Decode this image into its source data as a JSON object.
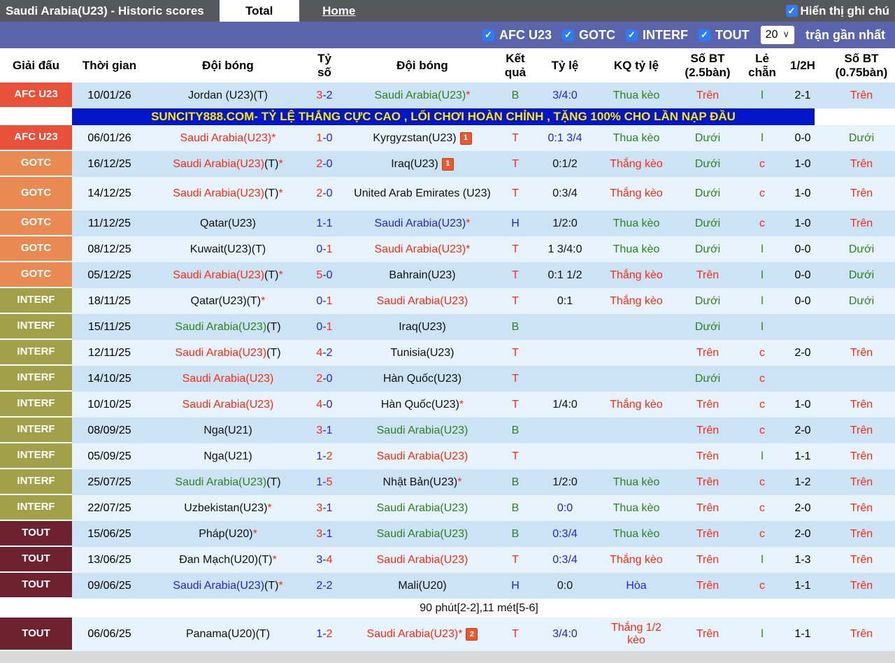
{
  "header": {
    "title": "Saudi Arabia(U23) - Historic scores",
    "tabs": [
      {
        "label": "Total",
        "active": true
      },
      {
        "label": "Home",
        "active": false
      }
    ],
    "note_toggle": "Hiển thị ghi chú"
  },
  "filters": {
    "competitions": [
      "AFC U23",
      "GOTC",
      "INTERF",
      "TOUT"
    ],
    "count_value": "20",
    "count_suffix": "trận gần nhất"
  },
  "ad": {
    "text": "SUNCITY888.COM- TỶ LỆ THẮNG CỰC CAO , LỐI CHƠI HOÀN CHỈNH , TẶNG 100% CHO LẦN NẠP ĐẦU",
    "bg": "#0016c8",
    "fg": "#ffe600"
  },
  "note_row": {
    "text": "90 phút[2-2],11 mét[5-6]"
  },
  "colors": {
    "win_text": "#fe2a10",
    "loss_text": "#31811c",
    "draw_text": "#2323dc",
    "row_dark": "#cbe3f4",
    "row_light": "#e7f3fb",
    "filter_bar": "#5964ad",
    "title_bar": "#57585c"
  },
  "table": {
    "columns": [
      "Giải đấu",
      "Thời gian",
      "Đội bóng",
      "Tỷ số",
      "Đội bóng",
      "Kết quả",
      "Tỷ lệ",
      "KQ tỷ lệ",
      "Số BT (2.5bàn)",
      "Lẻ chẵn",
      "1/2H",
      "Số BT (0.75bàn)"
    ],
    "league_colors": {
      "AFC U23": "#e8503a",
      "GOTC": "#e98a52",
      "INTERF": "#a3a04a",
      "TOUT": "#6e2230"
    },
    "rows": [
      {
        "league": "AFC U23",
        "date": "10/01/26",
        "home": [
          [
            "Jordan (U23)(T)",
            "k"
          ]
        ],
        "score": [
          "3",
          "r",
          "2",
          "b"
        ],
        "away": [
          [
            "Saudi Arabia(U23)",
            "g"
          ],
          [
            "*",
            "r"
          ]
        ],
        "res": [
          "B",
          "g"
        ],
        "odds": [
          "3/4:0",
          "b"
        ],
        "kq": [
          "Thua kèo",
          "g"
        ],
        "ou25": [
          "Trên",
          "r"
        ],
        "oe": [
          "l",
          "g"
        ],
        "ht": "2-1",
        "ou075": [
          "Trên",
          "r"
        ],
        "after": "ad"
      },
      {
        "league": "AFC U23",
        "date": "06/01/26",
        "home": [
          [
            "Saudi Arabia(U23)",
            "r"
          ],
          [
            "*",
            "r"
          ]
        ],
        "score": [
          "1",
          "r",
          "0",
          "b"
        ],
        "away": [
          [
            "Kyrgyzstan(U23)",
            "k"
          ]
        ],
        "note_badge": "1",
        "res": [
          "T",
          "r"
        ],
        "odds": [
          "0:1 3/4",
          "b"
        ],
        "kq": [
          "Thua kèo",
          "g"
        ],
        "ou25": [
          "Dưới",
          "g"
        ],
        "oe": [
          "l",
          "g"
        ],
        "ht": "0-0",
        "ou075": [
          "Dưới",
          "g"
        ]
      },
      {
        "league": "GOTC",
        "date": "16/12/25",
        "home": [
          [
            "Saudi Arabia(U23)",
            "r"
          ],
          [
            "(T)",
            "k"
          ],
          [
            "*",
            "r"
          ]
        ],
        "score": [
          "2",
          "r",
          "0",
          "b"
        ],
        "away": [
          [
            "Iraq(U23)",
            "k"
          ]
        ],
        "note_badge": "1",
        "res": [
          "T",
          "r"
        ],
        "odds": [
          "0:1/2",
          "k"
        ],
        "kq": [
          "Thắng kèo",
          "r"
        ],
        "ou25": [
          "Dưới",
          "g"
        ],
        "oe": [
          "c",
          "r"
        ],
        "ht": "1-0",
        "ou075": [
          "Trên",
          "r"
        ]
      },
      {
        "league": "GOTC",
        "date": "14/12/25",
        "home": [
          [
            "Saudi Arabia(U23)",
            "r"
          ],
          [
            "(T)",
            "k"
          ],
          [
            "*",
            "r"
          ]
        ],
        "score": [
          "2",
          "r",
          "0",
          "b"
        ],
        "away": [
          [
            "United Arab Emirates (U23)",
            "k"
          ]
        ],
        "res": [
          "T",
          "r"
        ],
        "odds": [
          "0:3/4",
          "k"
        ],
        "kq": [
          "Thắng kèo",
          "r"
        ],
        "ou25": [
          "Dưới",
          "g"
        ],
        "oe": [
          "c",
          "r"
        ],
        "ht": "1-0",
        "ou075": [
          "Trên",
          "r"
        ],
        "tall": true
      },
      {
        "league": "GOTC",
        "date": "11/12/25",
        "home": [
          [
            "Qatar(U23)",
            "k"
          ]
        ],
        "score": [
          "1",
          "b",
          "1",
          "b"
        ],
        "away": [
          [
            "Saudi Arabia(U23)",
            "b"
          ],
          [
            "*",
            "r"
          ]
        ],
        "res": [
          "H",
          "b"
        ],
        "odds": [
          "1/2:0",
          "k"
        ],
        "kq": [
          "Thua kèo",
          "g"
        ],
        "ou25": [
          "Dưới",
          "g"
        ],
        "oe": [
          "c",
          "r"
        ],
        "ht": "1-0",
        "ou075": [
          "Trên",
          "r"
        ]
      },
      {
        "league": "GOTC",
        "date": "08/12/25",
        "home": [
          [
            "Kuwait(U23)(T)",
            "k"
          ]
        ],
        "score": [
          "0",
          "b",
          "1",
          "r"
        ],
        "away": [
          [
            "Saudi Arabia(U23)",
            "r"
          ],
          [
            "*",
            "r"
          ]
        ],
        "res": [
          "T",
          "r"
        ],
        "odds": [
          "1 3/4:0",
          "k"
        ],
        "kq": [
          "Thua kèo",
          "g"
        ],
        "ou25": [
          "Dưới",
          "g"
        ],
        "oe": [
          "l",
          "g"
        ],
        "ht": "0-0",
        "ou075": [
          "Dưới",
          "g"
        ]
      },
      {
        "league": "GOTC",
        "date": "05/12/25",
        "home": [
          [
            "Saudi Arabia(U23)",
            "r"
          ],
          [
            "(T)",
            "k"
          ],
          [
            "*",
            "r"
          ]
        ],
        "score": [
          "5",
          "r",
          "0",
          "b"
        ],
        "away": [
          [
            "Bahrain(U23)",
            "k"
          ]
        ],
        "res": [
          "T",
          "r"
        ],
        "odds": [
          "0:1 1/2",
          "k"
        ],
        "kq": [
          "Thắng kèo",
          "r"
        ],
        "ou25": [
          "Trên",
          "r"
        ],
        "oe": [
          "l",
          "g"
        ],
        "ht": "0-0",
        "ou075": [
          "Dưới",
          "g"
        ]
      },
      {
        "league": "INTERF",
        "date": "18/11/25",
        "home": [
          [
            "Qatar(U23)(T)",
            "k"
          ],
          [
            "*",
            "r"
          ]
        ],
        "score": [
          "0",
          "b",
          "1",
          "r"
        ],
        "away": [
          [
            "Saudi Arabia(U23)",
            "r"
          ]
        ],
        "res": [
          "T",
          "r"
        ],
        "odds": [
          "0:1",
          "k"
        ],
        "kq": [
          "Thắng kèo",
          "r"
        ],
        "ou25": [
          "Dưới",
          "g"
        ],
        "oe": [
          "l",
          "g"
        ],
        "ht": "0-0",
        "ou075": [
          "Dưới",
          "g"
        ]
      },
      {
        "league": "INTERF",
        "date": "15/11/25",
        "home": [
          [
            "Saudi Arabia(U23)",
            "g"
          ],
          [
            "(T)",
            "k"
          ]
        ],
        "score": [
          "0",
          "b",
          "1",
          "r"
        ],
        "away": [
          [
            "Iraq(U23)",
            "k"
          ]
        ],
        "res": [
          "B",
          "g"
        ],
        "ou25": [
          "Dưới",
          "g"
        ],
        "oe": [
          "l",
          "g"
        ]
      },
      {
        "league": "INTERF",
        "date": "12/11/25",
        "home": [
          [
            "Saudi Arabia(U23)",
            "r"
          ],
          [
            "(T)",
            "k"
          ]
        ],
        "score": [
          "4",
          "r",
          "2",
          "b"
        ],
        "away": [
          [
            "Tunisia(U23)",
            "k"
          ]
        ],
        "res": [
          "T",
          "r"
        ],
        "ou25": [
          "Trên",
          "r"
        ],
        "oe": [
          "c",
          "r"
        ],
        "ht": "2-0",
        "ou075": [
          "Trên",
          "r"
        ]
      },
      {
        "league": "INTERF",
        "date": "14/10/25",
        "home": [
          [
            "Saudi Arabia(U23)",
            "r"
          ]
        ],
        "score": [
          "2",
          "r",
          "0",
          "b"
        ],
        "away": [
          [
            "Hàn Quốc(U23)",
            "k"
          ]
        ],
        "res": [
          "T",
          "r"
        ],
        "ou25": [
          "Dưới",
          "g"
        ],
        "oe": [
          "c",
          "r"
        ]
      },
      {
        "league": "INTERF",
        "date": "10/10/25",
        "home": [
          [
            "Saudi Arabia(U23)",
            "r"
          ]
        ],
        "score": [
          "4",
          "r",
          "0",
          "b"
        ],
        "away": [
          [
            "Hàn Quốc(U23)",
            "k"
          ],
          [
            "*",
            "r"
          ]
        ],
        "res": [
          "T",
          "r"
        ],
        "odds": [
          "1/4:0",
          "k"
        ],
        "kq": [
          "Thắng kèo",
          "r"
        ],
        "ou25": [
          "Trên",
          "r"
        ],
        "oe": [
          "c",
          "r"
        ],
        "ht": "1-0",
        "ou075": [
          "Trên",
          "r"
        ]
      },
      {
        "league": "INTERF",
        "date": "08/09/25",
        "home": [
          [
            "Nga(U21)",
            "k"
          ]
        ],
        "score": [
          "3",
          "r",
          "1",
          "b"
        ],
        "away": [
          [
            "Saudi Arabia(U23)",
            "g"
          ]
        ],
        "res": [
          "B",
          "g"
        ],
        "ou25": [
          "Trên",
          "r"
        ],
        "oe": [
          "c",
          "r"
        ],
        "ht": "2-0",
        "ou075": [
          "Trên",
          "r"
        ]
      },
      {
        "league": "INTERF",
        "date": "05/09/25",
        "home": [
          [
            "Nga(U21)",
            "k"
          ]
        ],
        "score": [
          "1",
          "b",
          "2",
          "r"
        ],
        "away": [
          [
            "Saudi Arabia(U23)",
            "r"
          ]
        ],
        "res": [
          "T",
          "r"
        ],
        "ou25": [
          "Trên",
          "r"
        ],
        "oe": [
          "l",
          "g"
        ],
        "ht": "1-1",
        "ou075": [
          "Trên",
          "r"
        ]
      },
      {
        "league": "INTERF",
        "date": "25/07/25",
        "home": [
          [
            "Saudi Arabia(U23)",
            "g"
          ],
          [
            "(T)",
            "k"
          ]
        ],
        "score": [
          "1",
          "b",
          "5",
          "r"
        ],
        "away": [
          [
            "Nhật Bản(U23)",
            "k"
          ],
          [
            "*",
            "r"
          ]
        ],
        "res": [
          "B",
          "g"
        ],
        "odds": [
          "1/2:0",
          "k"
        ],
        "kq": [
          "Thua kèo",
          "g"
        ],
        "ou25": [
          "Trên",
          "r"
        ],
        "oe": [
          "c",
          "r"
        ],
        "ht": "1-2",
        "ou075": [
          "Trên",
          "r"
        ]
      },
      {
        "league": "INTERF",
        "date": "22/07/25",
        "home": [
          [
            "Uzbekistan(U23)",
            "k"
          ],
          [
            "*",
            "r"
          ]
        ],
        "score": [
          "3",
          "r",
          "1",
          "b"
        ],
        "away": [
          [
            "Saudi Arabia(U23)",
            "g"
          ]
        ],
        "res": [
          "B",
          "g"
        ],
        "odds": [
          "0:0",
          "b"
        ],
        "kq": [
          "Thua kèo",
          "g"
        ],
        "ou25": [
          "Trên",
          "r"
        ],
        "oe": [
          "c",
          "r"
        ],
        "ht": "2-0",
        "ou075": [
          "Trên",
          "r"
        ]
      },
      {
        "league": "TOUT",
        "date": "15/06/25",
        "home": [
          [
            "Pháp(U20)",
            "k"
          ],
          [
            "*",
            "r"
          ]
        ],
        "score": [
          "3",
          "r",
          "1",
          "b"
        ],
        "away": [
          [
            "Saudi Arabia(U23)",
            "g"
          ]
        ],
        "res": [
          "B",
          "g"
        ],
        "odds": [
          "0:3/4",
          "b"
        ],
        "kq": [
          "Thua kèo",
          "g"
        ],
        "ou25": [
          "Trên",
          "r"
        ],
        "oe": [
          "c",
          "r"
        ],
        "ht": "2-0",
        "ou075": [
          "Trên",
          "r"
        ]
      },
      {
        "league": "TOUT",
        "date": "13/06/25",
        "home": [
          [
            "Đan Mạch(U20)(T)",
            "k"
          ],
          [
            "*",
            "r"
          ]
        ],
        "score": [
          "3",
          "b",
          "4",
          "r"
        ],
        "away": [
          [
            "Saudi Arabia(U23)",
            "r"
          ]
        ],
        "res": [
          "T",
          "r"
        ],
        "odds": [
          "0:3/4",
          "b"
        ],
        "kq": [
          "Thắng kèo",
          "r"
        ],
        "ou25": [
          "Trên",
          "r"
        ],
        "oe": [
          "l",
          "g"
        ],
        "ht": "1-3",
        "ou075": [
          "Trên",
          "r"
        ]
      },
      {
        "league": "TOUT",
        "date": "09/06/25",
        "home": [
          [
            "Saudi Arabia(U23)",
            "b"
          ],
          [
            "(T)",
            "k"
          ],
          [
            "*",
            "r"
          ]
        ],
        "score": [
          "2",
          "b",
          "2",
          "b"
        ],
        "away": [
          [
            "Mali(U20)",
            "k"
          ]
        ],
        "res": [
          "H",
          "b"
        ],
        "odds": [
          "0:0",
          "k"
        ],
        "kq": [
          "Hòa",
          "b"
        ],
        "ou25": [
          "Trên",
          "r"
        ],
        "oe": [
          "c",
          "r"
        ],
        "ht": "1-1",
        "ou075": [
          "Trên",
          "r"
        ],
        "after": "note"
      },
      {
        "league": "TOUT",
        "date": "06/06/25",
        "home": [
          [
            "Panama(U20)(T)",
            "k"
          ]
        ],
        "score": [
          "1",
          "b",
          "2",
          "r"
        ],
        "away": [
          [
            "Saudi Arabia(U23)",
            "r"
          ],
          [
            "*",
            "r"
          ]
        ],
        "note_badge": "2",
        "res": [
          "T",
          "r"
        ],
        "odds": [
          "3/4:0",
          "b"
        ],
        "kq": [
          "Thắng 1/2 kèo",
          "r"
        ],
        "ou25": [
          "Trên",
          "r"
        ],
        "oe": [
          "l",
          "g"
        ],
        "ht": "1-1",
        "ou075": [
          "Trên",
          "r"
        ],
        "tall": true
      }
    ]
  }
}
